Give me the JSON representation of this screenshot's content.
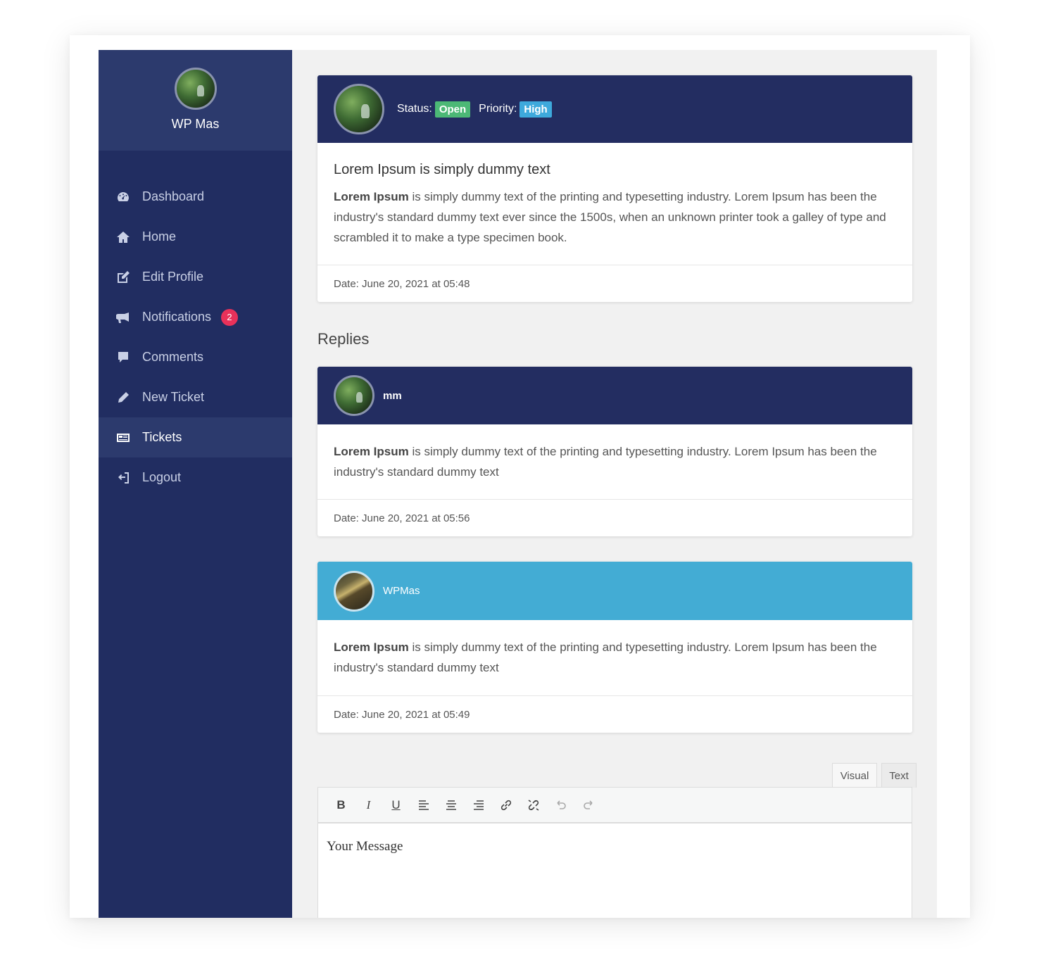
{
  "sidebar": {
    "profile_name": "WP Mas",
    "items": [
      {
        "label": "Dashboard",
        "icon": "dashboard-icon"
      },
      {
        "label": "Home",
        "icon": "home-icon"
      },
      {
        "label": "Edit Profile",
        "icon": "edit-profile-icon"
      },
      {
        "label": "Notifications",
        "icon": "megaphone-icon",
        "badge": "2"
      },
      {
        "label": "Comments",
        "icon": "comment-icon"
      },
      {
        "label": "New Ticket",
        "icon": "pencil-icon"
      },
      {
        "label": "Tickets",
        "icon": "ticket-icon",
        "active": true
      },
      {
        "label": "Logout",
        "icon": "logout-icon"
      }
    ]
  },
  "ticket": {
    "status_label": "Status:",
    "status_value": "Open",
    "priority_label": "Priority:",
    "priority_value": "High",
    "title": "Lorem Ipsum is simply dummy text",
    "body_bold": "Lorem Ipsum",
    "body_rest": " is simply dummy text of the printing and typesetting industry. Lorem Ipsum has been the industry's standard dummy text ever since the 1500s, when an unknown printer took a galley of type and scrambled it to make a type specimen book.",
    "date": "Date: June 20, 2021 at 05:48"
  },
  "replies_heading": "Replies",
  "replies": [
    {
      "author": "mm",
      "body_bold": "Lorem Ipsum",
      "body_rest": " is simply dummy text of the printing and typesetting industry. Lorem Ipsum has been the industry's standard dummy text",
      "date": "Date: June 20, 2021 at 05:56"
    },
    {
      "author": "WPMas",
      "body_bold": "Lorem Ipsum",
      "body_rest": " is simply dummy text of the printing and typesetting industry. Lorem Ipsum has been the industry's standard dummy text",
      "date": "Date: June 20, 2021 at 05:49"
    }
  ],
  "editor": {
    "tab_visual": "Visual",
    "tab_text": "Text",
    "bold": "B",
    "italic": "I",
    "underline": "U",
    "placeholder": "Your Message"
  },
  "colors": {
    "sidebar": "#212d61",
    "sidebar_active": "#2c3a6d",
    "card_header_navy": "#232d61",
    "card_header_teal": "#43acd4",
    "status_open": "#4cb876",
    "priority_high": "#3ea9dc",
    "badge": "#e8315a"
  }
}
